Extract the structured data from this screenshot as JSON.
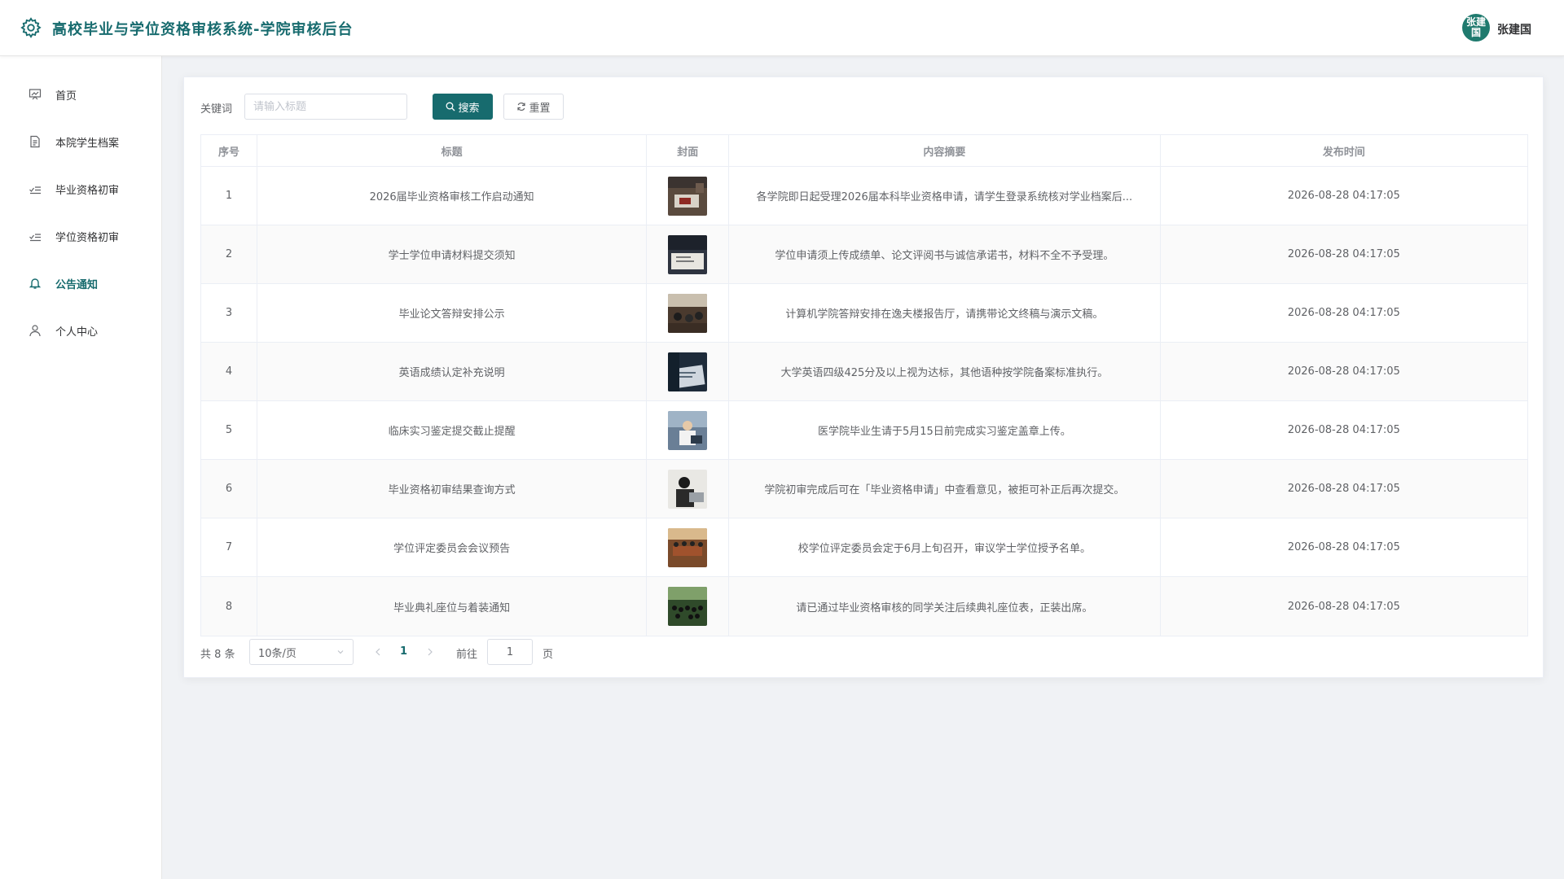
{
  "header": {
    "app_title": "高校毕业与学位资格审核系统-学院审核后台",
    "avatar_text": "张建国",
    "user_name": "张建国"
  },
  "sidebar": {
    "items": [
      {
        "label": "首页",
        "icon": "dashboard-icon"
      },
      {
        "label": "本院学生档案",
        "icon": "document-icon"
      },
      {
        "label": "毕业资格初审",
        "icon": "checklist-icon"
      },
      {
        "label": "学位资格初审",
        "icon": "checklist-icon"
      },
      {
        "label": "公告通知",
        "icon": "bell-icon",
        "active": true
      },
      {
        "label": "个人中心",
        "icon": "user-icon"
      }
    ]
  },
  "search": {
    "label": "关键词",
    "placeholder": "请输入标题",
    "value": "",
    "search_button": "搜索",
    "reset_button": "重置"
  },
  "table": {
    "headers": [
      "序号",
      "标题",
      "封面",
      "内容摘要",
      "发布时间"
    ],
    "rows": [
      {
        "index": "1",
        "title": "2026届毕业资格审核工作启动通知",
        "summary": "各学院即日起受理2026届本科毕业资格申请，请学生登录系统核对学业档案后...",
        "time": "2026-08-28 04:17:05"
      },
      {
        "index": "2",
        "title": "学士学位申请材料提交须知",
        "summary": "学位申请须上传成绩单、论文评阅书与诚信承诺书，材料不全不予受理。",
        "time": "2026-08-28 04:17:05"
      },
      {
        "index": "3",
        "title": "毕业论文答辩安排公示",
        "summary": "计算机学院答辩安排在逸夫楼报告厅，请携带论文终稿与演示文稿。",
        "time": "2026-08-28 04:17:05"
      },
      {
        "index": "4",
        "title": "英语成绩认定补充说明",
        "summary": "大学英语四级425分及以上视为达标，其他语种按学院备案标准执行。",
        "time": "2026-08-28 04:17:05"
      },
      {
        "index": "5",
        "title": "临床实习鉴定提交截止提醒",
        "summary": "医学院毕业生请于5月15日前完成实习鉴定盖章上传。",
        "time": "2026-08-28 04:17:05"
      },
      {
        "index": "6",
        "title": "毕业资格初审结果查询方式",
        "summary": "学院初审完成后可在「毕业资格申请」中查看意见，被拒可补正后再次提交。",
        "time": "2026-08-28 04:17:05"
      },
      {
        "index": "7",
        "title": "学位评定委员会会议预告",
        "summary": "校学位评定委员会定于6月上旬召开，审议学士学位授予名单。",
        "time": "2026-08-28 04:17:05"
      },
      {
        "index": "8",
        "title": "毕业典礼座位与着装通知",
        "summary": "请已通过毕业资格审核的同学关注后续典礼座位表，正装出席。",
        "time": "2026-08-28 04:17:05"
      }
    ]
  },
  "pagination": {
    "total_text": "共 8 条",
    "page_size": "10条/页",
    "current_page": "1",
    "goto_label": "前往",
    "goto_value": "1",
    "page_unit": "页"
  },
  "colors": {
    "brand": "#176b6e",
    "background": "#f0f2f5"
  }
}
